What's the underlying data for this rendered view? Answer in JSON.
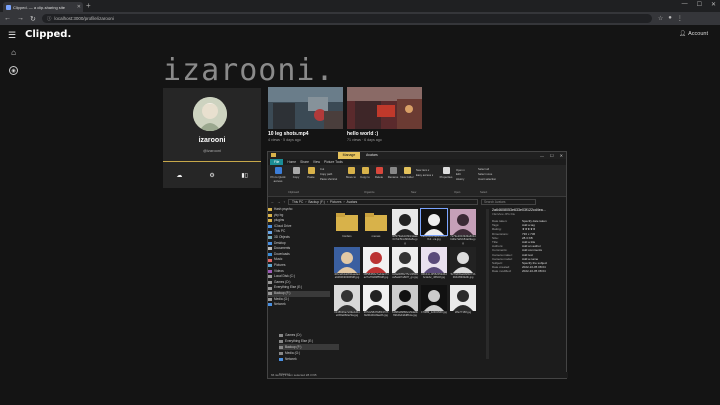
{
  "browser": {
    "tab_title": "Clipped. — a clip-sharing site",
    "url": "localhost:3000/profile/izarooni"
  },
  "app": {
    "brand": "Clipped.",
    "account_label": "Account"
  },
  "profile": {
    "username_big": "izarooni.",
    "name": "izarooni",
    "handle": "@izarooni"
  },
  "clips": [
    {
      "title": "10 leg shots.mp4",
      "meta": "4 views · 5 days ago"
    },
    {
      "title": "hello world :)",
      "meta": "71 views · 6 days ago"
    }
  ],
  "explorer": {
    "context_tab": "Manage",
    "window_name": "Avatars",
    "tabs": [
      "File",
      "Home",
      "Share",
      "View",
      "Picture Tools"
    ],
    "ribbon": {
      "pin": "Pin to Quick access",
      "copy": "Copy",
      "paste": "Paste",
      "cut": "Cut",
      "copy_path": "Copy path",
      "paste_shortcut": "Paste shortcut",
      "move_to": "Move to",
      "copy_to": "Copy to",
      "delete": "Delete",
      "rename": "Rename",
      "new_folder": "New folder",
      "new_item": "New item ▾",
      "easy_access": "Easy access ▾",
      "properties": "Properties",
      "open": "Open ▾",
      "edit": "Edit",
      "history": "History",
      "select_all": "Select all",
      "select_none": "Select none",
      "invert_selection": "Invert selection",
      "groups": [
        "Clipboard",
        "Organize",
        "New",
        "Open",
        "Select"
      ]
    },
    "breadcrumb": [
      "This PC",
      "Backup (F:)",
      "Pictures",
      "Avatars"
    ],
    "search_placeholder": "Search Avatars",
    "nav_items": [
      "Hash psycho",
      "yky bg",
      "plugins",
      "iCloud Drive",
      "This PC",
      "3D Objects",
      "Desktop",
      "Documents",
      "Downloads",
      "Music",
      "Pictures",
      "Videos",
      "Local Disk (C:)",
      "Games (D:)",
      "Everything Else (E:)",
      "Backup (F:)",
      "Media (G:)",
      "Network"
    ],
    "files": [
      {
        "name": "borders"
      },
      {
        "name": "memes"
      },
      {
        "name": "f3f5f79abdc093cdaab047dc5bcd9b6e8a.jpg"
      },
      {
        "name": "2a64608053e633e03f12...ca.jpg"
      },
      {
        "name": "7e79e20b39d9a602dbd0e7a8cb84a09a.jpg"
      },
      {
        "name": "40bcafb2ab811aa4a1a6d60b90306fd8.jpg"
      },
      {
        "name": "39f58df9bc7adda47da27a7f0d9855d8.jpg"
      },
      {
        "name": "919a0085275cc9f999ca5ad27a807f_gn.jpg"
      },
      {
        "name": "84b44c-9f552052d4dbcdebc_4f8d4f.jpg"
      },
      {
        "name": "5279d0faa9b89274b3b6c89fdfe0b.jpg"
      },
      {
        "name": "0148f4f0a7e99ebdb4e0b5a660a7da.jpg"
      },
      {
        "name": "3972e58d7b8f437258e90d41b8ae6b.jpg"
      },
      {
        "name": "61884d6ff6fbc29da0b69b4bd4dd8b1a.jpg"
      },
      {
        "name": "17088f_1240zMf0.jpg"
      },
      {
        "name": "28a77158.jpg"
      }
    ],
    "details": {
      "title": "2a64608053e633e03f122cd4ea...",
      "subtitle": "IrfanView JPG File",
      "rows": [
        {
          "k": "Date taken:",
          "v": "Specify date taken"
        },
        {
          "k": "Tags:",
          "v": "Add a tag"
        },
        {
          "k": "Rating:",
          "v": "★★★★★"
        },
        {
          "k": "Dimensions:",
          "v": "736 x 736"
        },
        {
          "k": "Size:",
          "v": "28.3 KB"
        },
        {
          "k": "Title:",
          "v": "Add a title"
        },
        {
          "k": "Authors:",
          "v": "Add an author"
        },
        {
          "k": "Comments:",
          "v": "Add comments"
        },
        {
          "k": "Camera maker:",
          "v": "Add text"
        },
        {
          "k": "Camera model:",
          "v": "Add a name"
        },
        {
          "k": "Subject:",
          "v": "Specify the subject"
        },
        {
          "k": "Date created:",
          "v": "2022-10-05 08:04"
        },
        {
          "k": "Date modified:",
          "v": "2022-10-05 08:04"
        }
      ]
    },
    "status": "66 items  |  1 item selected  28.3 KB",
    "status2": "9 items  |"
  },
  "drives": [
    "Games (D:)",
    "Everything Else (E:)",
    "Backup (F:)",
    "Media (G:)",
    "Network"
  ]
}
